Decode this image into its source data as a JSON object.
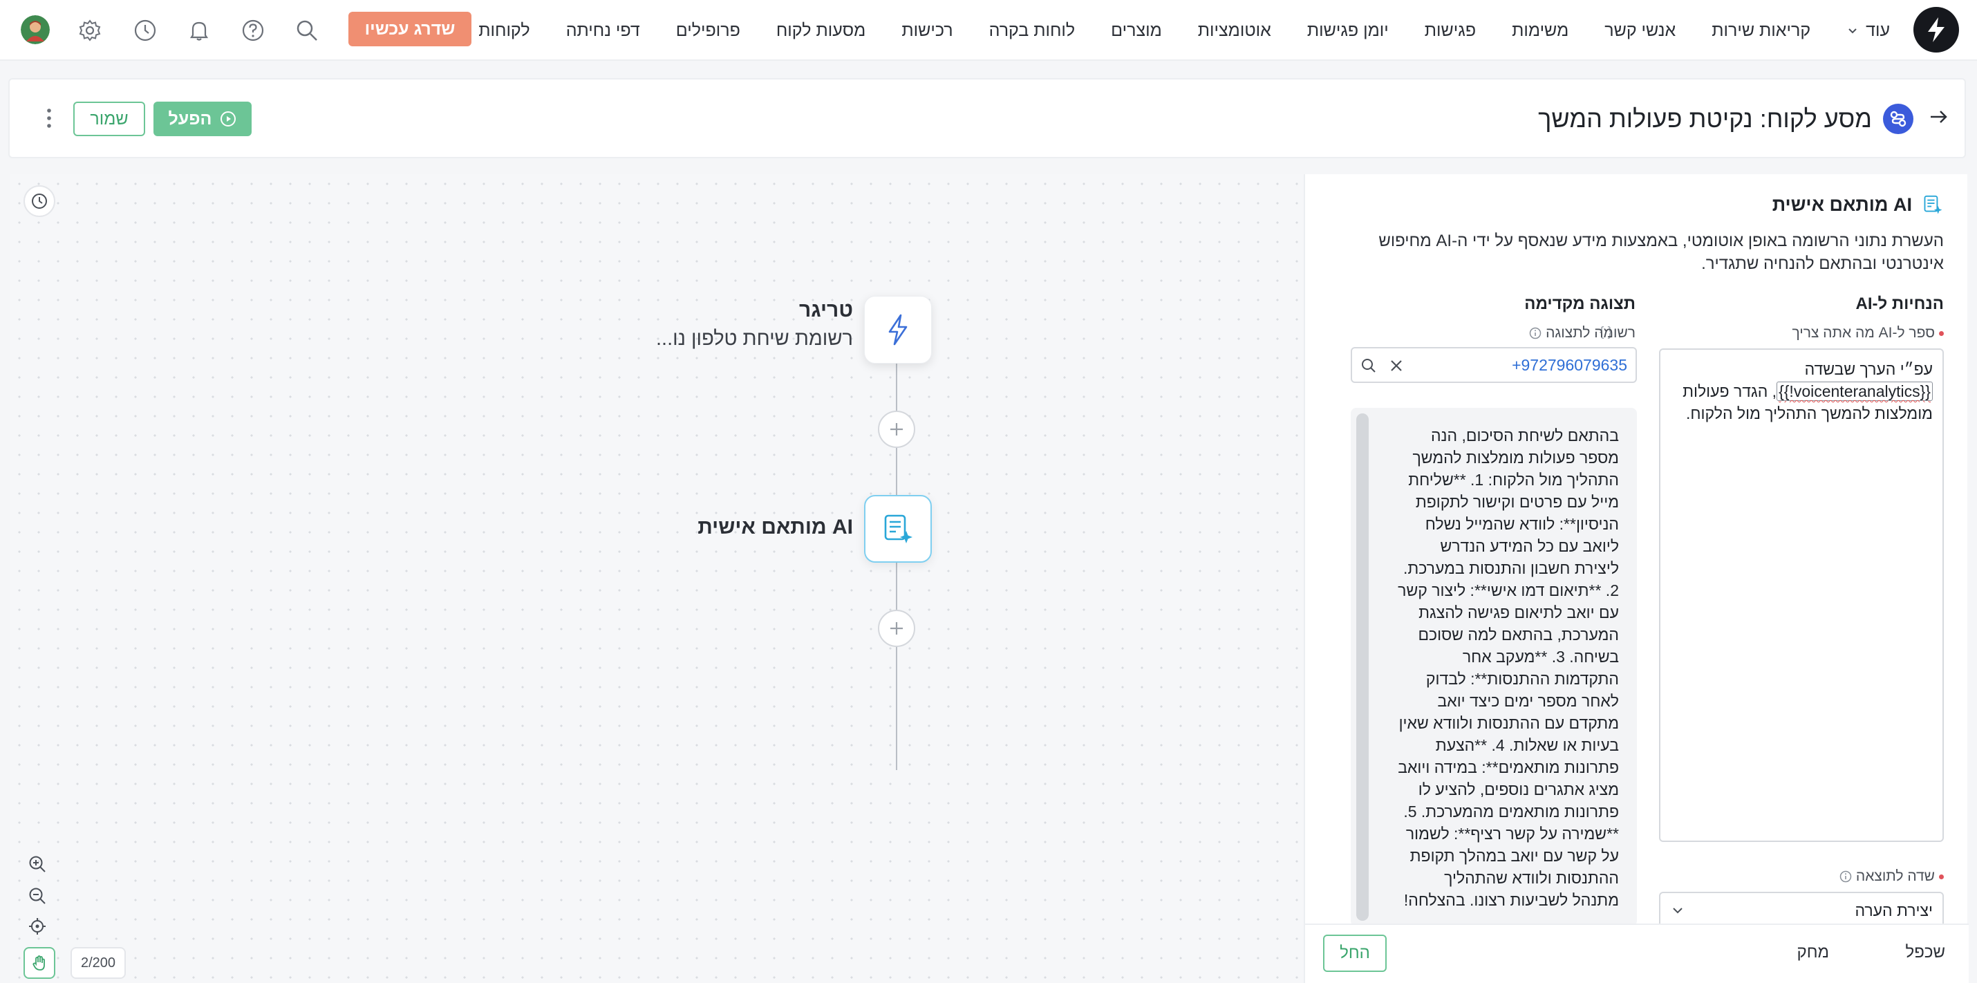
{
  "nav": {
    "items": [
      "לקוחות",
      "דפי נחיתה",
      "פרופילים",
      "מסעות לקוח",
      "רכישות",
      "לוחות בקרה",
      "מוצרים",
      "אוטומציות",
      "יומן פגישות",
      "פגישות",
      "משימות",
      "אנשי קשר",
      "קריאות שירות"
    ],
    "more_label": "עוד",
    "upgrade_label": "שדרג עכשיו",
    "upgrade_color": "#f08f72"
  },
  "titlebar": {
    "title": "מסע לקוח: נקיטת פעולות המשך",
    "activate_label": "הפעל",
    "save_label": "שמור",
    "accent_color": "#6cc596"
  },
  "flow": {
    "trigger": {
      "title": "טריגר",
      "subtitle": "רשומת שיחת טלפון נו..."
    },
    "ai_node": {
      "title": "AI מותאם אישית"
    },
    "counter": "2/200"
  },
  "panel": {
    "title": "AI מותאם אישית",
    "description": "העשרת נתוני הרשומה באופן אוטומטי, באמצעות מידע שנאסף על ידי ה-AI מחיפוש אינטרנטי ובהתאם להנחיה שתגדיר.",
    "instructions_title": "הנחיות ל-AI",
    "prompt_label": "ספר ל-AI מה אתה צריך",
    "braces": "{ }",
    "prompt_before": "עפ״י הערך שבשדה ",
    "prompt_var": "{{!voicenteranalytics}}",
    "prompt_after": ", הגדר פעולות מומלצות להמשך התהליך מול הלקוח.",
    "preview_title": "תצוגה מקדימה",
    "preview_record_label": "רשומה לתצוגה",
    "preview_record_value": "+972796079635",
    "preview_text": "בהתאם לשיחת הסיכום, הנה מספר פעולות מומלצות להמשך התהליך מול הלקוח: 1. **שליחת מייל עם פרטים וקישור לתקופת הניסיון**: לוודא שהמייל נשלח ליואב עם כל המידע הנדרש ליצירת חשבון והתנסות במערכת. 2. **תיאום דמו אישי**: ליצור קשר עם יואב לתיאום פגישה להצגת המערכת, בהתאם למה שסוכם בשיחה. 3. **מעקב אחר התקדמות ההתנסות**: לבדוק לאחר מספר ימים כיצד יואב מתקדם עם ההתנסות ולוודא שאין בעיות או שאלות. 4. **הצעת פתרונות מותאמים**: במידה ויואב מציג אתגרים נוספים, להציע לו פתרונות מותאמים מהמערכת. 5. **שמירה על קשר רציף**: לשמור על קשר עם יואב במהלך תקופת ההתנסות ולוודא שהתהליך מתנהל לשביעות רצונו. בהצלחה!",
    "output_field_label": "שדה לתוצאה",
    "output_field_value": "יצירת הערה",
    "footer": {
      "duplicate": "שכפל",
      "delete": "מחק",
      "start": "החל"
    }
  }
}
